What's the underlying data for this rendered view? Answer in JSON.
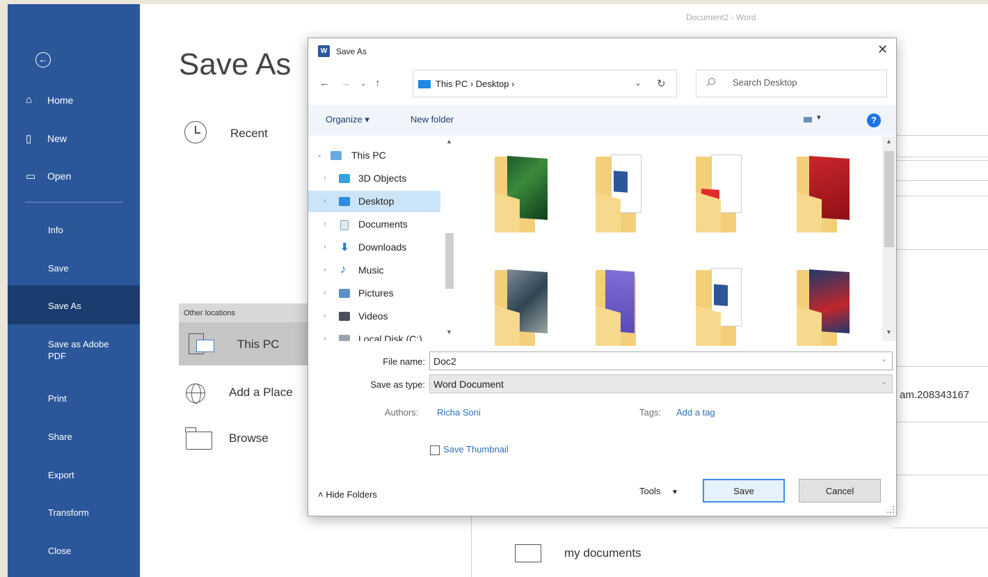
{
  "window": {
    "title": "Document2  -  Word"
  },
  "sidebar": {
    "items": [
      {
        "label": "Home",
        "icon": "home-icon"
      },
      {
        "label": "New",
        "icon": "new-document-icon"
      },
      {
        "label": "Open",
        "icon": "open-folder-icon"
      },
      {
        "label": "Info"
      },
      {
        "label": "Save"
      },
      {
        "label": "Save As",
        "active": true
      },
      {
        "label": "Save as Adobe PDF"
      },
      {
        "label": "Print"
      },
      {
        "label": "Share"
      },
      {
        "label": "Export"
      },
      {
        "label": "Transform"
      },
      {
        "label": "Close"
      }
    ]
  },
  "backstage": {
    "title": "Save As",
    "recent": "Recent",
    "other_locations": "Other locations",
    "this_pc": "This PC",
    "add_place": "Add a Place",
    "browse": "Browse",
    "truncated_text": "am.208343167",
    "my_documents": "my documents"
  },
  "dialog": {
    "title": "Save As",
    "close": "✕",
    "address": {
      "parts": "This PC  ›  Desktop  ›"
    },
    "search_placeholder": "Search Desktop",
    "organize": "Organize ▾",
    "new_folder": "New folder",
    "help": "?",
    "nav_tree": [
      {
        "label": "This PC",
        "expanded": true
      },
      {
        "label": "3D Objects"
      },
      {
        "label": "Desktop",
        "selected": true
      },
      {
        "label": "Documents"
      },
      {
        "label": "Downloads"
      },
      {
        "label": "Music"
      },
      {
        "label": "Pictures"
      },
      {
        "label": "Videos"
      },
      {
        "label": "Local Disk (C:)"
      }
    ],
    "file_name_label": "File name:",
    "file_name_value": "Doc2",
    "save_type_label": "Save as type:",
    "save_type_value": "Word Document",
    "authors_label": "Authors:",
    "authors_value": "Richa Soni",
    "tags_label": "Tags:",
    "tags_value": "Add a tag",
    "save_thumbnail": "Save Thumbnail",
    "hide_folders": "Hide Folders",
    "tools": "Tools",
    "save": "Save",
    "cancel": "Cancel"
  },
  "colors": {
    "sidebar": "#2b579a",
    "sidebar_active": "#1b3c6e",
    "accent": "#1e73e8",
    "folder": "#f3cf7a"
  }
}
